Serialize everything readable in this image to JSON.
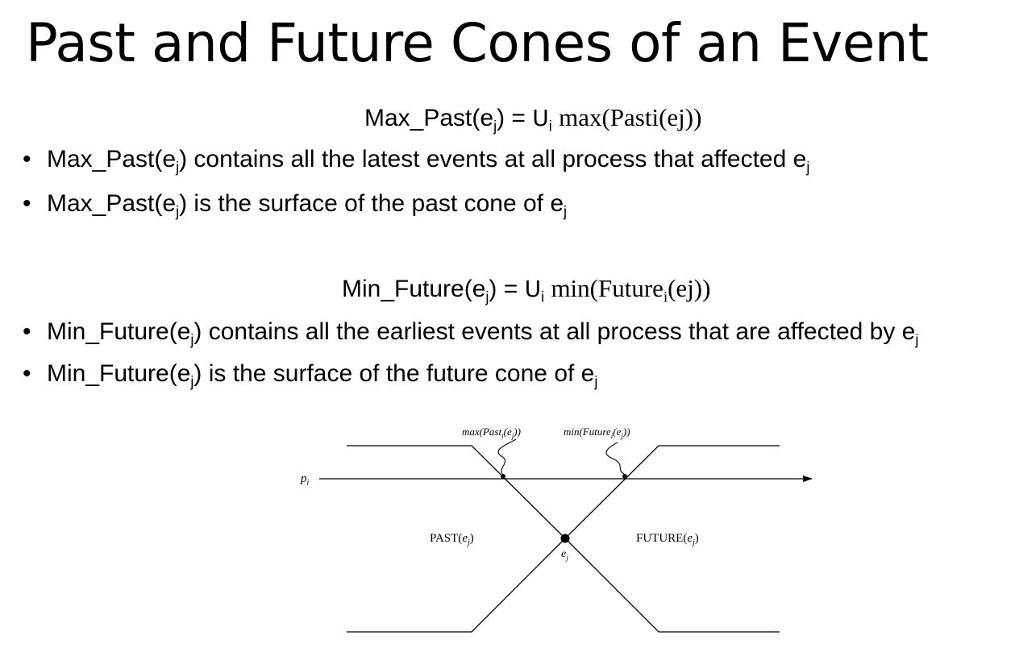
{
  "title": "Past and Future Cones of an Event",
  "formula1": {
    "lhs": "Max_Past(e",
    "lhs_sub": "j",
    "lhs_close": ") = ",
    "cup": "U",
    "cup_sub": "i",
    "rhs": "max(Pasti(ej))"
  },
  "formula2": {
    "lhs": "Min_Future(e",
    "lhs_sub": "j",
    "lhs_close": ") = ",
    "cup": "U",
    "cup_sub": "i",
    "rhs_a": "min(Future",
    "rhs_sub": "i",
    "rhs_b": "(ej))"
  },
  "bullets": [
    {
      "a": "Max_Past(e",
      "s1": "j",
      "b": ") contains all the latest events at all process that affected e",
      "s2": "j"
    },
    {
      "a": "Max_Past(e",
      "s1": "j",
      "b": ") is the surface of the past cone of e",
      "s2": "j"
    },
    {
      "a": "Min_Future(e",
      "s1": "j",
      "b": ") contains all the earliest events at all process that are affected by e",
      "s2": "j"
    },
    {
      "a": "Min_Future(e",
      "s1": "j",
      "b": ") is the surface of the future cone of e",
      "s2": "j"
    }
  ],
  "diagram": {
    "process": "p",
    "process_sub": "i",
    "max_label": {
      "a": "max(Past",
      "s1": "i",
      "b": "(e",
      "s2": "j",
      "c": "))"
    },
    "min_label": {
      "a": "min(Future",
      "s1": "i",
      "b": "(e",
      "s2": "j",
      "c": "))"
    },
    "past_label": {
      "a": "PAST(",
      "b": "e",
      "s": "j",
      "c": ")"
    },
    "future_label": {
      "a": "FUTURE(",
      "b": "e",
      "s": "j",
      "c": ")"
    },
    "event": "e",
    "event_sub": "j"
  }
}
